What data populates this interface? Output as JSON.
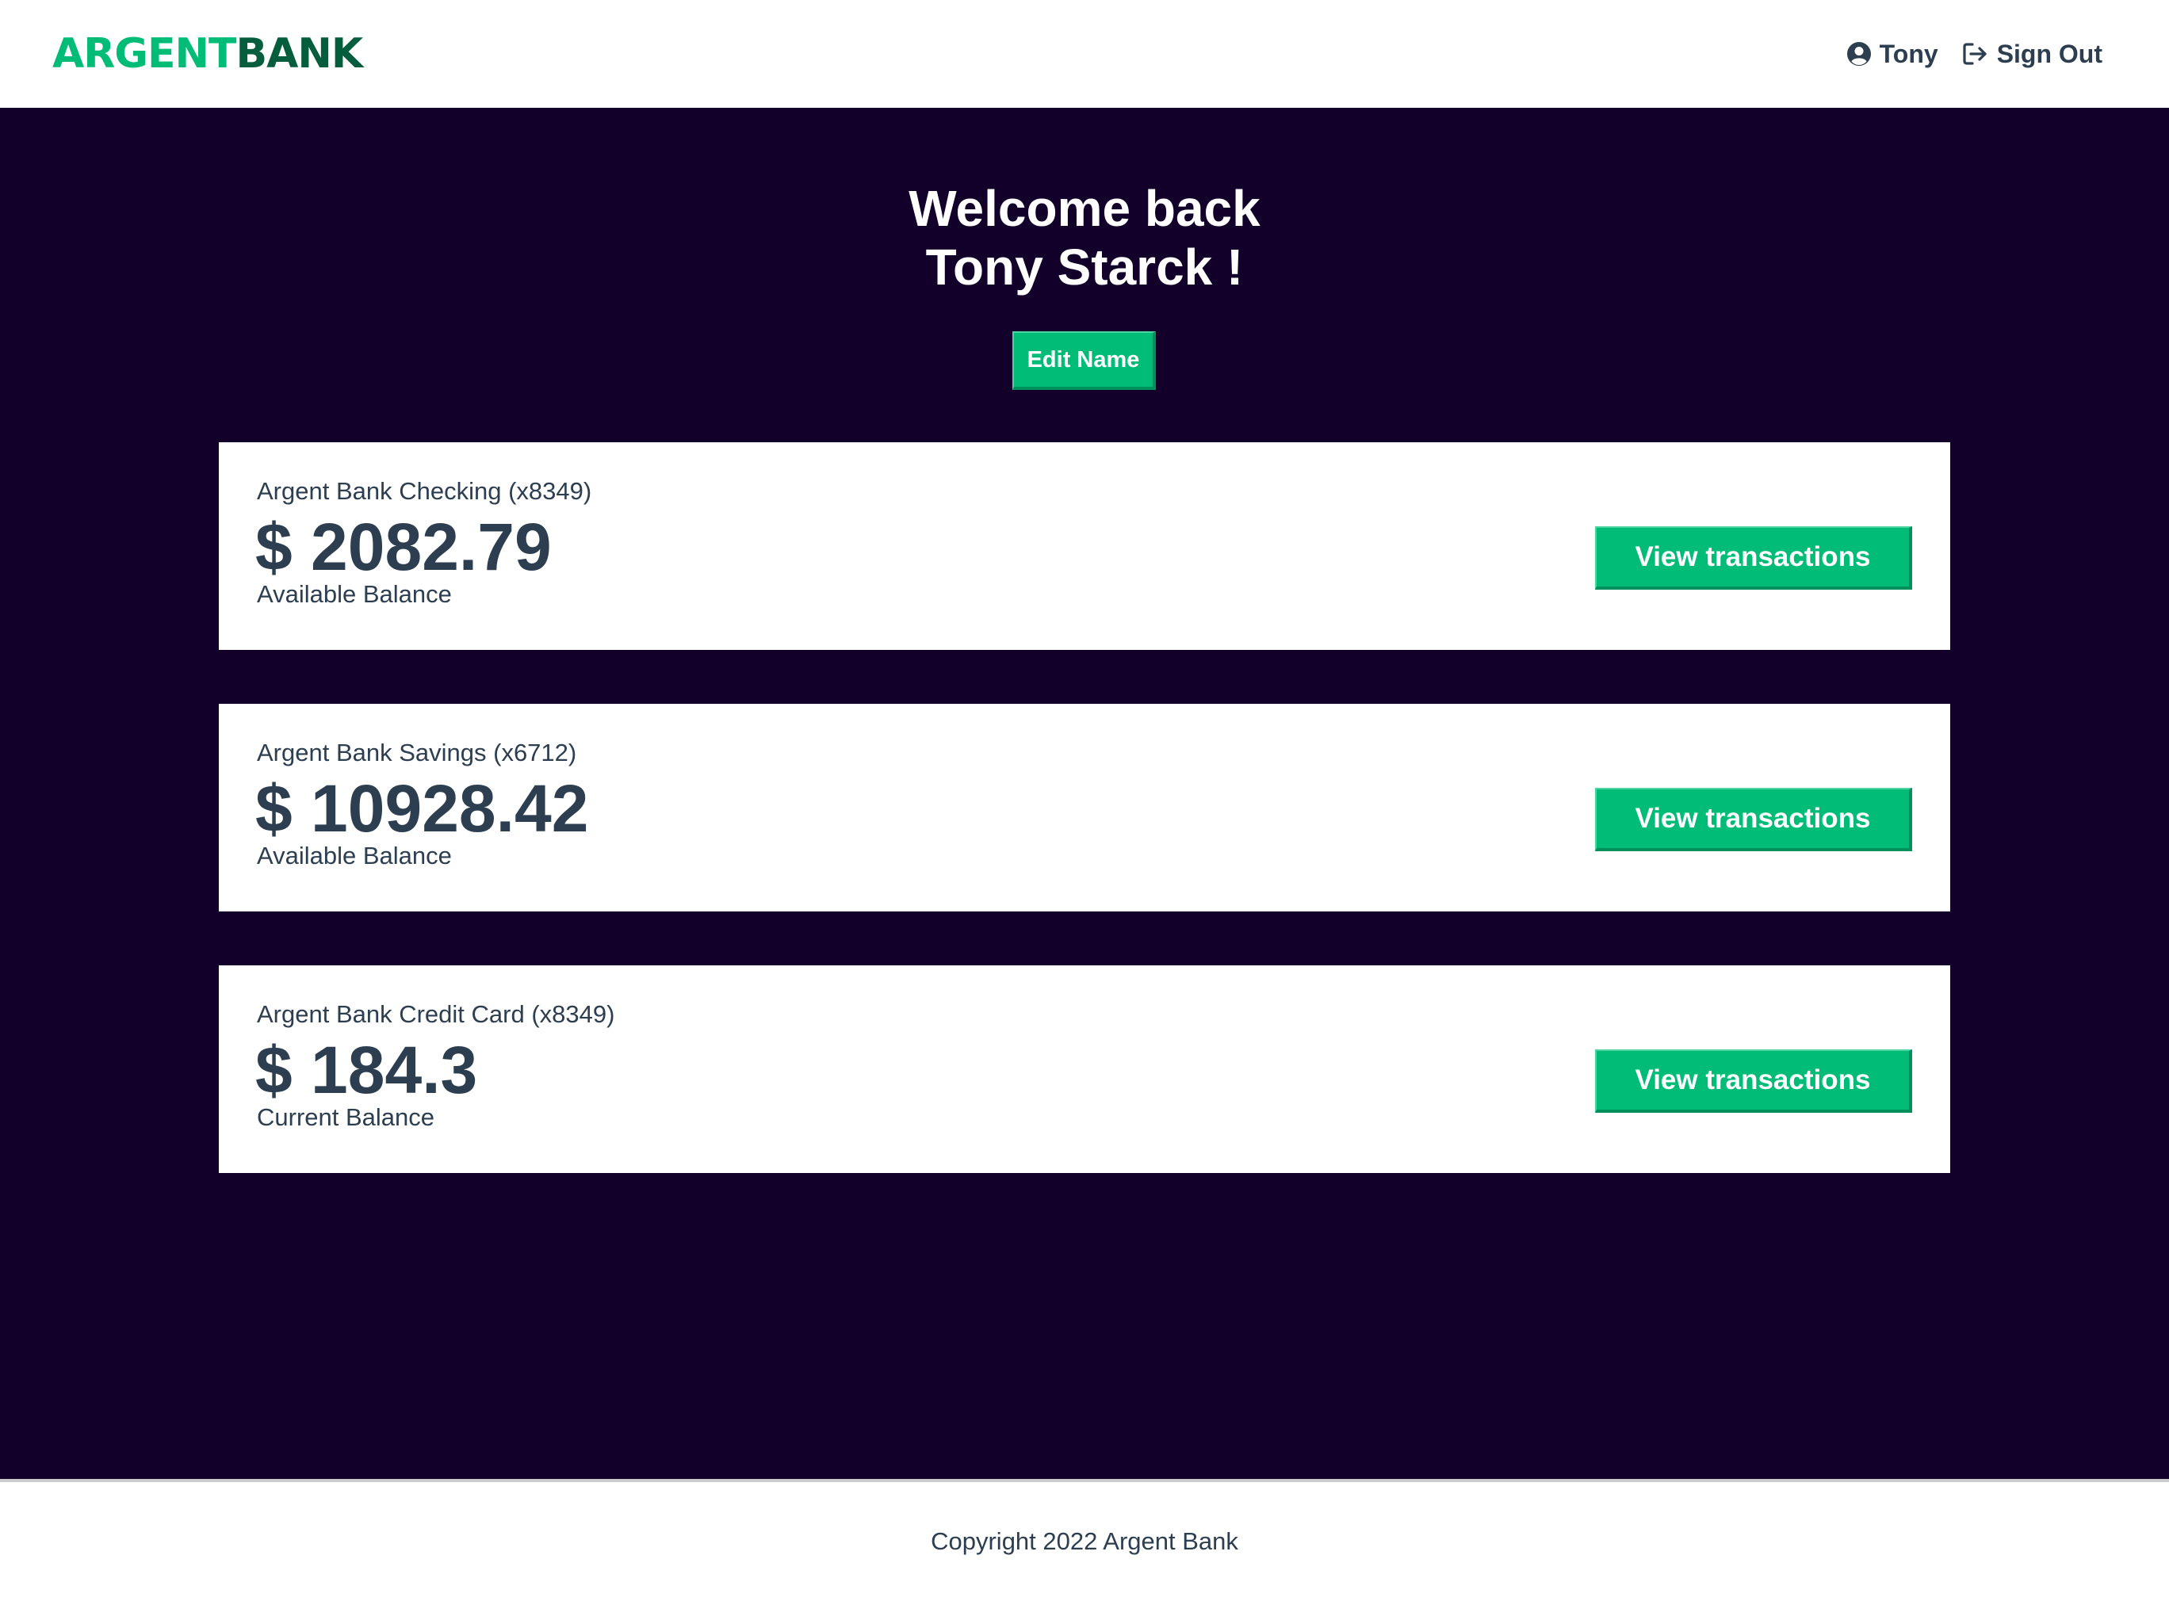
{
  "header": {
    "logo_part1": "ARGENT",
    "logo_part2": "BANK",
    "user_name": "Tony",
    "user_icon": "user-circle-icon",
    "signout_label": "Sign Out",
    "signout_icon": "sign-out-icon"
  },
  "main": {
    "welcome_line1": "Welcome back",
    "welcome_line2": "Tony Starck !",
    "edit_name_label": "Edit Name",
    "accounts": [
      {
        "title": "Argent Bank Checking (x8349)",
        "amount": "$ 2082.79",
        "description": "Available Balance",
        "button_label": "View transactions"
      },
      {
        "title": "Argent Bank Savings (x6712)",
        "amount": "$ 10928.42",
        "description": "Available Balance",
        "button_label": "View transactions"
      },
      {
        "title": "Argent Bank Credit Card (x8349)",
        "amount": "$ 184.3",
        "description": "Current Balance",
        "button_label": "View transactions"
      }
    ]
  },
  "footer": {
    "copyright": "Copyright 2022 Argent Bank"
  },
  "colors": {
    "accent": "#00bc77",
    "brand_dark": "#045d3c",
    "background_dark": "#12002b",
    "text": "#2c3e50"
  }
}
